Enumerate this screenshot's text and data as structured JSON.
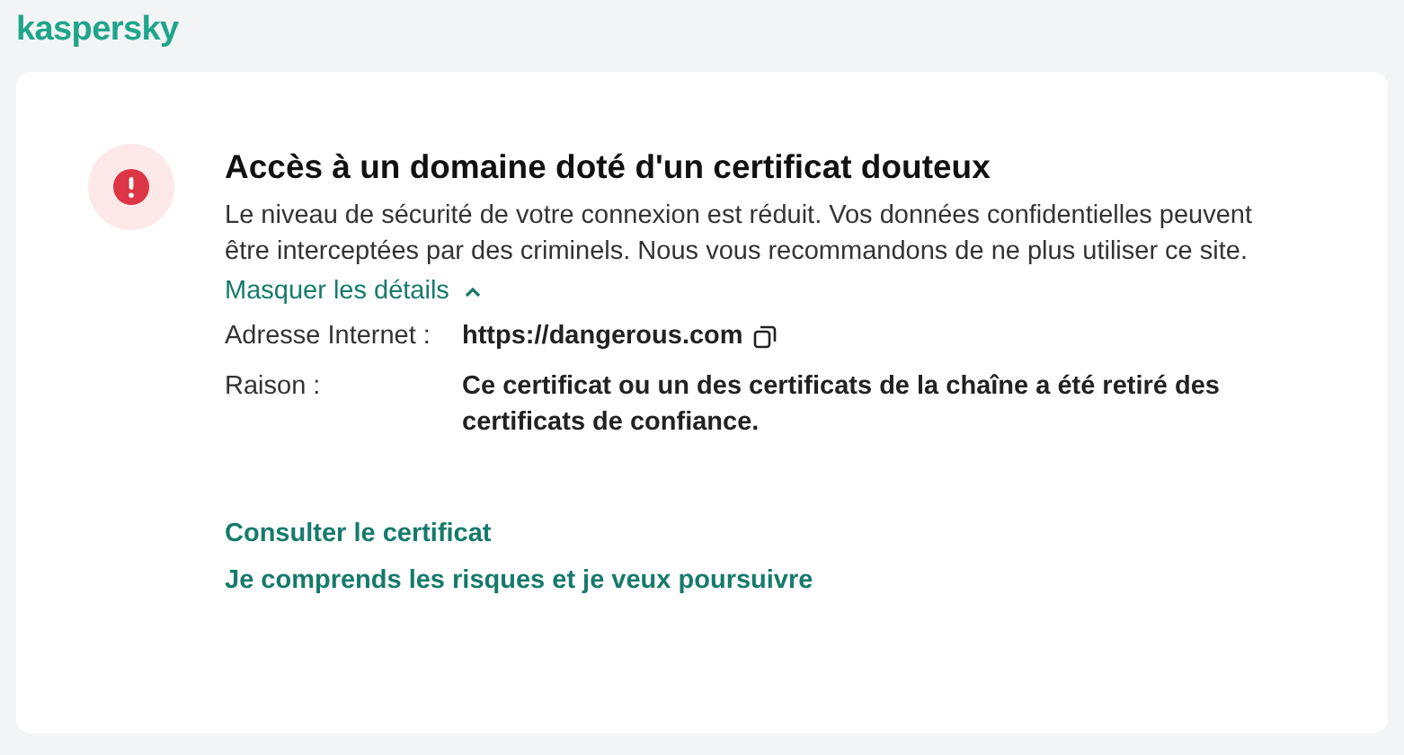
{
  "logo": "kaspersky",
  "alert": {
    "title": "Accès à un domaine doté d'un certificat douteux",
    "message": "Le niveau de sécurité de votre connexion est réduit. Vos données confidentielles peuvent être interceptées par des criminels. Nous vous recommandons de ne plus utiliser ce site.",
    "details_toggle": {
      "label": "Masquer les détails",
      "expanded": true
    },
    "details": [
      {
        "label": "Adresse Internet :",
        "value": "https://dangerous.com",
        "kind": "copyable"
      },
      {
        "label": "Raison :",
        "value": "Ce certificat ou un des certificats de la chaîne a été retiré des certificats de confiance.",
        "kind": "text"
      }
    ],
    "links": [
      "Consulter le certificat",
      "Je comprends les risques et je veux poursuivre"
    ]
  }
}
